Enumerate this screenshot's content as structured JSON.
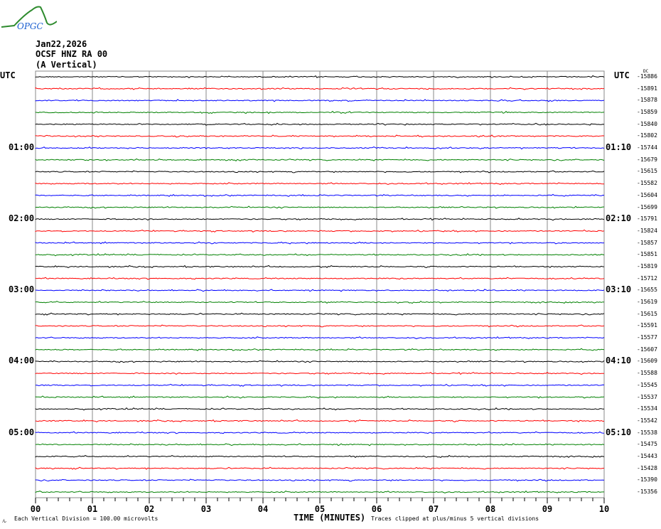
{
  "logo": {
    "text": "OPGC",
    "colors": {
      "curve": "#2e8b2e",
      "text": "#1a5fd0"
    }
  },
  "header": {
    "date": "Jan22,2026",
    "station": "OCSF HNZ RA 00",
    "component": "(A Vertical)"
  },
  "chart_data": {
    "type": "line",
    "title": "OCSF HNZ RA 00 (A Vertical) Jan22,2026",
    "xlabel": "TIME (MINUTES)",
    "x_ticks": [
      "00",
      "01",
      "02",
      "03",
      "04",
      "05",
      "06",
      "07",
      "08",
      "09",
      "10"
    ],
    "xlim": [
      0,
      10
    ],
    "left_axis_title": "UTC",
    "right_axis_title": "UTC",
    "dc_label": "DC",
    "left_time_labels": [
      {
        "row": 6,
        "label": "01:00"
      },
      {
        "row": 12,
        "label": "02:00"
      },
      {
        "row": 18,
        "label": "03:00"
      },
      {
        "row": 24,
        "label": "04:00"
      },
      {
        "row": 30,
        "label": "05:00"
      }
    ],
    "right_time_labels": [
      {
        "row": 6,
        "label": "01:10"
      },
      {
        "row": 12,
        "label": "02:10"
      },
      {
        "row": 18,
        "label": "03:10"
      },
      {
        "row": 24,
        "label": "04:10"
      },
      {
        "row": 30,
        "label": "05:10"
      }
    ],
    "dc_offsets": [
      "-15886",
      "-15891",
      "-15878",
      "-15859",
      "-15840",
      "-15802",
      "-15744",
      "-15679",
      "-15615",
      "-15582",
      "-15604",
      "-15699",
      "-15791",
      "-15824",
      "-15857",
      "-15851",
      "-15819",
      "-15712",
      "-15655",
      "-15619",
      "-15615",
      "-15591",
      "-15577",
      "-15607",
      "-15609",
      "-15588",
      "-15545",
      "-15537",
      "-15534",
      "-15542",
      "-15538",
      "-15475",
      "-15443",
      "-15428",
      "-15390",
      "-15356"
    ],
    "trace_colors": [
      "#000000",
      "#ff0000",
      "#0000ff",
      "#008000"
    ],
    "grid": true
  },
  "footer": {
    "corner": "ん",
    "scale": "Each Vertical Division =  100.00 microvolts",
    "clip": "Traces clipped at plus/minus 5 vertical divisions"
  }
}
